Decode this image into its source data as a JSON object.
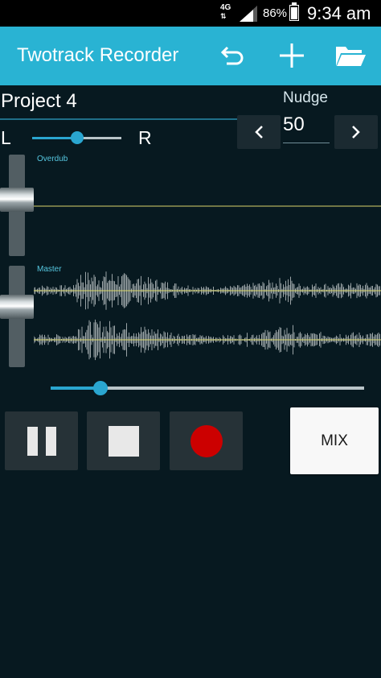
{
  "status_bar": {
    "network": "4G",
    "network_arrows": "⇅",
    "battery_percent": "86%",
    "battery_level": 0.86,
    "time": "9:34 am"
  },
  "action_bar": {
    "title": "Twotrack Recorder",
    "icons": [
      "undo-icon",
      "add-icon",
      "open-folder-icon"
    ],
    "background": "#29b3d3"
  },
  "project": {
    "name": "Project 4"
  },
  "nudge": {
    "label": "Nudge",
    "value": "50"
  },
  "pan": {
    "left_label": "L",
    "right_label": "R",
    "position": 0.5
  },
  "tracks": [
    {
      "label": "Overdub",
      "fader_level": 0.43,
      "has_audio": false
    },
    {
      "label": "Master",
      "fader_level": 0.37,
      "has_audio": true
    }
  ],
  "playback": {
    "position": 0.16
  },
  "transport": {
    "pause_icon": "pause-icon",
    "stop_icon": "stop-icon",
    "record_icon": "record-icon",
    "mix_label": "MIX"
  },
  "colors": {
    "accent": "#2aa6d0",
    "background": "#071920",
    "waveform": "#9aa3a6",
    "center_line": "#d8d46a",
    "record": "#cc0000"
  }
}
